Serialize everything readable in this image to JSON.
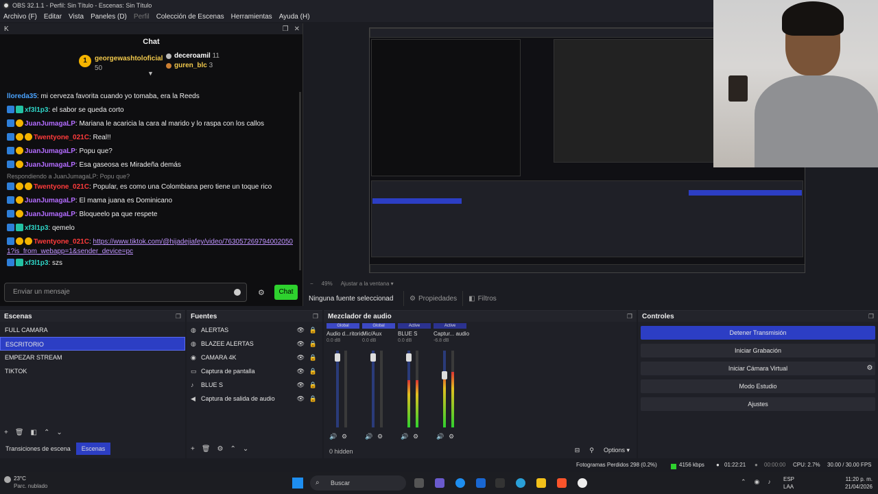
{
  "titlebar": {
    "title": "OBS 32.1.1 - Perfil: Sin Título - Escenas: Sin Título"
  },
  "menu": [
    "Archivo (F)",
    "Editar",
    "Vista",
    "Paneles (D)",
    "Perfil",
    "Colección de Escenas",
    "Herramientas",
    "Ayuda (H)"
  ],
  "chat": {
    "dock_title": "K",
    "title": "Chat",
    "leaderboard": {
      "first_name": "georgewashtoloficial",
      "first_count": "50",
      "second_name": "deceroamil",
      "second_count": "11",
      "third_name": "guren_blc",
      "third_count": "3"
    },
    "messages": [
      {
        "user": "lloreda35",
        "color": "#4aa3ff",
        "text": ": mi cerveza favorita cuando yo tomaba, era la Reeds",
        "badges": []
      },
      {
        "user": "xf3l1p3",
        "color": "#2fd6c8",
        "text": ": el sabor se queda corto",
        "badges": [
          "blue",
          "teal"
        ]
      },
      {
        "user": "JuanJumagaLP",
        "color": "#b36cff",
        "text": ": Mariana le acaricia la cara al marido y lo raspa con los callos",
        "badges": [
          "blue",
          "gold"
        ]
      },
      {
        "user": "Twentyone_021C",
        "color": "#ff3b3b",
        "text": ": Real!!",
        "badges": [
          "blue",
          "gold",
          "gold"
        ]
      },
      {
        "user": "JuanJumagaLP",
        "color": "#b36cff",
        "text": ": Popu que?",
        "badges": [
          "blue",
          "gold"
        ]
      },
      {
        "user": "JuanJumagaLP",
        "color": "#b36cff",
        "text": ": Esa gaseosa es Miradeña demás",
        "badges": [
          "blue",
          "gold"
        ]
      },
      {
        "user": "Twentyone_021C",
        "color": "#ff3b3b",
        "text": ": Popular, es como una Colombiana pero tiene un toque rico",
        "badges": [
          "blue",
          "gold",
          "gold"
        ],
        "reply": "Respondiendo a JuanJumagaLP: Popu que?"
      },
      {
        "user": "JuanJumagaLP",
        "color": "#b36cff",
        "text": ": El mama juana es Dominicano",
        "badges": [
          "blue",
          "gold"
        ]
      },
      {
        "user": "JuanJumagaLP",
        "color": "#b36cff",
        "text": ": Bloqueelo pa que respete",
        "badges": [
          "blue",
          "gold"
        ]
      },
      {
        "user": "xf3l1p3",
        "color": "#2fd6c8",
        "text": ": qemelo",
        "badges": [
          "blue",
          "teal"
        ]
      },
      {
        "user": "Twentyone_021C",
        "color": "#ff3b3b",
        "text": ": ",
        "link": "https://www.tiktok.com/@hijadejiafey/video/7630572697940020501?is_from_webapp=1&sender_device=pc",
        "badges": [
          "blue",
          "gold",
          "gold"
        ]
      },
      {
        "user": "xf3l1p3",
        "color": "#2fd6c8",
        "text": ": szs",
        "badges": [
          "blue",
          "teal"
        ]
      }
    ],
    "input_placeholder": "Enviar un mensaje",
    "send_label": "Chat"
  },
  "preview": {
    "zoom": "49%",
    "fit_label": "Ajustar a la ventana"
  },
  "source_bar": {
    "no_selection": "Ninguna fuente seleccionad",
    "properties": "Propiedades",
    "filters": "Filtros"
  },
  "scenes": {
    "title": "Escenas",
    "items": [
      "FULL CAMARA",
      "ESCRITORIO",
      "EMPEZAR STREAM",
      "TIKTOK"
    ],
    "selected": 1,
    "tab_transitions": "Transiciones de escena",
    "tab_scenes": "Escenas"
  },
  "sources": {
    "title": "Fuentes",
    "items": [
      {
        "label": "ALERTAS",
        "icon": "globe-icon"
      },
      {
        "label": "BLAZEE ALERTAS",
        "icon": "globe-icon"
      },
      {
        "label": "CAMARA 4K",
        "icon": "camera-icon"
      },
      {
        "label": "Captura de pantalla",
        "icon": "monitor-icon"
      },
      {
        "label": "BLUE S",
        "icon": "mic-icon"
      },
      {
        "label": "Captura de salida de audio",
        "icon": "speaker-icon"
      }
    ]
  },
  "mixer": {
    "title": "Mezclador de audio",
    "channels": [
      {
        "tag": "Global",
        "name": "Audio d...ritorio",
        "db": "0.0 dB",
        "level": 0.0
      },
      {
        "tag": "Global",
        "name": "Mic/Aux",
        "db": "0.0 dB",
        "level": 0.0
      },
      {
        "tag": "Active",
        "name": "BLUE S",
        "db": "0.0 dB",
        "level": 0.62
      },
      {
        "tag": "Active",
        "name": "Captur... audio",
        "db": "-6.8 dB",
        "level": 0.72
      }
    ],
    "hidden": "0 hidden",
    "options": "Options"
  },
  "controls": {
    "title": "Controles",
    "buttons": [
      "Detener Transmisión",
      "Iniciar Grabación",
      "Iniciar Cámara Virtual",
      "Modo Estudio",
      "Ajustes"
    ]
  },
  "status": {
    "dropped": "Fotogramas Perdidos 298 (0.2%)",
    "bitrate": "4156 kbps",
    "live_time": "01:22:21",
    "rec_time": "00:00:00",
    "cpu": "CPU: 2.7%",
    "fps": "30.00 / 30.00 FPS"
  },
  "taskbar": {
    "temp": "23°C",
    "weather": "Parc. nublado",
    "search": "Buscar",
    "lang1": "ESP",
    "lang2": "LAA",
    "time": "11:20 p. m.",
    "date": "21/04/2026"
  },
  "colors": {
    "accent": "#2c3ec4",
    "chat_green": "#2ed12e",
    "net_green": "#2ed12e"
  }
}
